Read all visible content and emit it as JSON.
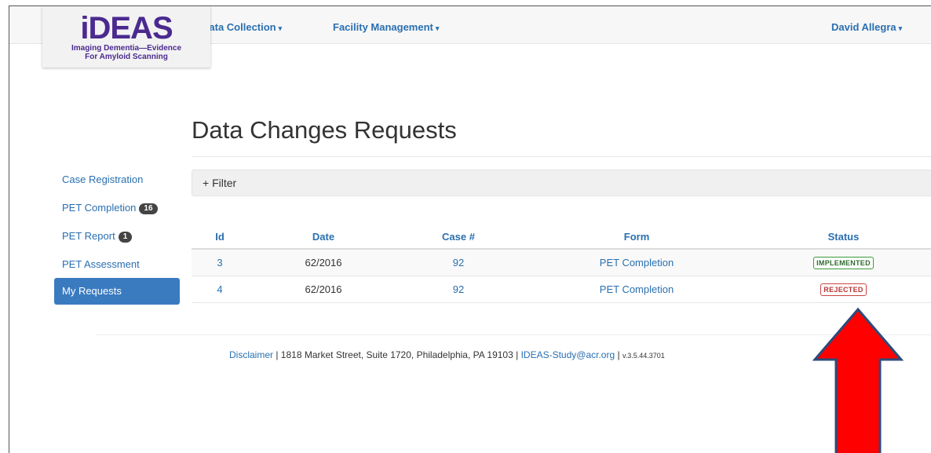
{
  "logo": {
    "wordmark": "iDEAS",
    "tagline_line1": "Imaging Dementia—Evidence",
    "tagline_line2": "For Amyloid Scanning"
  },
  "navbar": {
    "items": [
      {
        "label": "Data Collection"
      },
      {
        "label": "Facility Management"
      }
    ],
    "user": "David Allegra"
  },
  "page": {
    "title": "Data Changes Requests"
  },
  "sidebar": {
    "items": [
      {
        "label": "Case Registration",
        "badge": null,
        "active": false
      },
      {
        "label": "PET Completion",
        "badge": "16",
        "active": false
      },
      {
        "label": "PET Report",
        "badge": "1",
        "active": false
      },
      {
        "label": "PET Assessment",
        "badge": null,
        "active": false
      },
      {
        "label": "My Requests",
        "badge": null,
        "active": true
      }
    ]
  },
  "filter": {
    "label": "+ Filter"
  },
  "table": {
    "columns": [
      "Id",
      "Date",
      "Case #",
      "Form",
      "Status"
    ],
    "rows": [
      {
        "id": "3",
        "date": "62/2016",
        "case": "92",
        "form": "PET Completion",
        "status": "IMPLEMENTED"
      },
      {
        "id": "4",
        "date": "62/2016",
        "case": "92",
        "form": "PET Completion",
        "status": "REJECTED"
      }
    ]
  },
  "footer": {
    "disclaimer": "Disclaimer",
    "address": " | 1818 Market Street, Suite 1720, Philadelphia, PA 19103 | ",
    "email": "IDEAS-Study@acr.org",
    "sep": " | ",
    "version": "v.3.5.44.3701"
  },
  "colors": {
    "brand": "#4b2a8f",
    "link": "#2a6fb0",
    "active": "#3a7bc0",
    "arrow": "#ff0000"
  },
  "annotation": {
    "shape": "red-arrow-up"
  }
}
